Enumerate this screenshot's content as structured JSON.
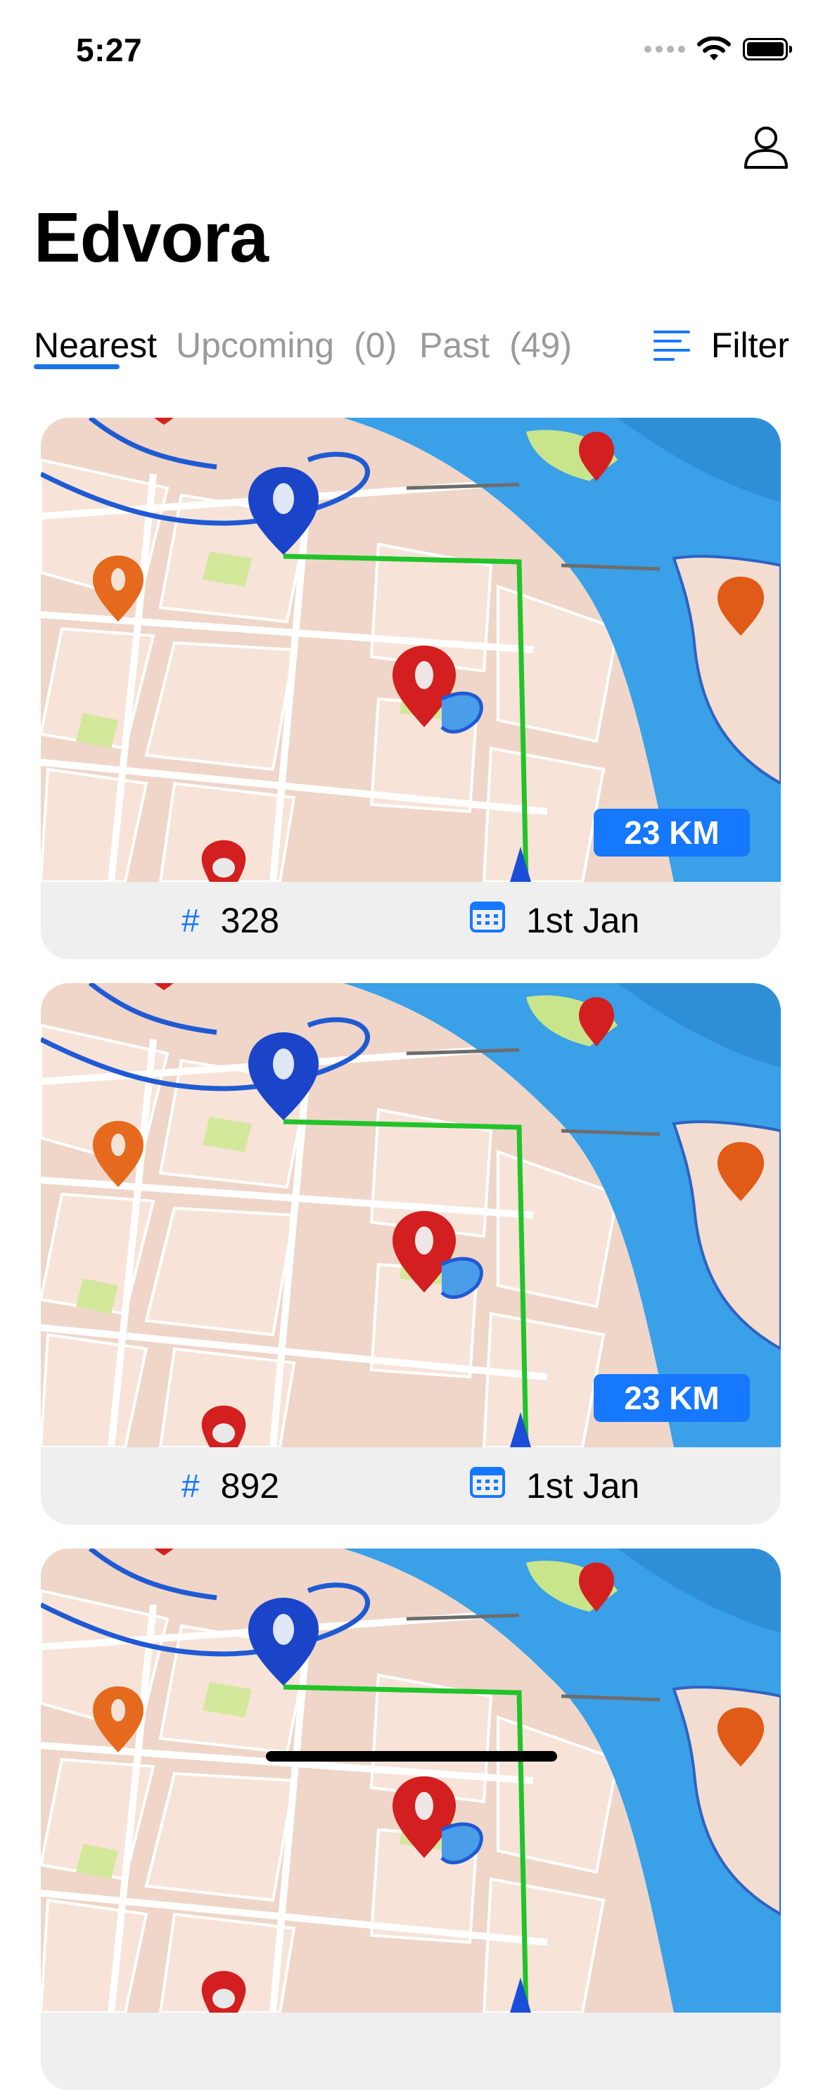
{
  "status_bar": {
    "time": "5:27"
  },
  "header": {
    "title": "Edvora",
    "profile_icon": "person-outline-icon"
  },
  "tabs": [
    {
      "label": "Nearest",
      "count": "",
      "active": true
    },
    {
      "label": "Upcoming",
      "count": "(0)",
      "active": false
    },
    {
      "label": "Past",
      "count": "(49)",
      "active": false
    }
  ],
  "filter": {
    "label": "Filter",
    "icon": "filter-lines-icon"
  },
  "rides": [
    {
      "id": "328",
      "date": "1st Jan",
      "distance": "23 KM"
    },
    {
      "id": "892",
      "date": "1st Jan",
      "distance": "23 KM"
    },
    {
      "id": "",
      "date": "",
      "distance": ""
    }
  ],
  "colors": {
    "accent": "#1677ff",
    "card_bg": "#efefef",
    "inactive_tab": "#9a9a9a"
  }
}
